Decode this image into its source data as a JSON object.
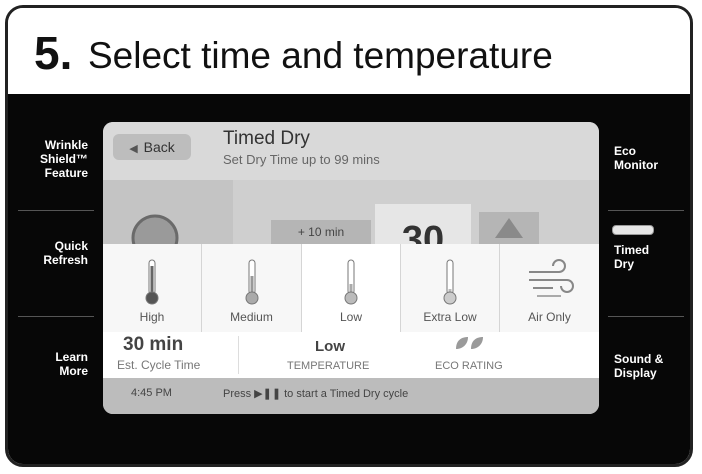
{
  "header": {
    "step_number": "5.",
    "title": "Select time and temperature"
  },
  "left_menu": [
    {
      "id": "wrinkle",
      "lines": [
        "Wrinkle",
        "Shield™",
        "Feature"
      ]
    },
    {
      "id": "quick",
      "lines": [
        "Quick",
        "Refresh"
      ]
    },
    {
      "id": "learn",
      "lines": [
        "Learn",
        "More"
      ]
    }
  ],
  "right_menu": [
    {
      "id": "eco",
      "lines": [
        "Eco",
        "Monitor"
      ]
    },
    {
      "id": "timed",
      "lines": [
        "Timed",
        "Dry"
      ],
      "selected": true
    },
    {
      "id": "sound",
      "lines": [
        "Sound &",
        "Display"
      ]
    }
  ],
  "screen": {
    "back_label": "Back",
    "cycle_title": "Timed Dry",
    "cycle_subtitle": "Set Dry Time up to 99 mins",
    "plus_time": "+ 10 min",
    "time_digits": "30",
    "temperature_options": [
      {
        "label": "High",
        "icon": "thermometer-high-icon"
      },
      {
        "label": "Medium",
        "icon": "thermometer-medium-icon"
      },
      {
        "label": "Low",
        "icon": "thermometer-low-icon",
        "selected": true
      },
      {
        "label": "Extra Low",
        "icon": "thermometer-extra-low-icon"
      },
      {
        "label": "Air Only",
        "icon": "air-wind-icon"
      }
    ],
    "info": {
      "cycle_time_value": "30 min",
      "cycle_time_label": "Est. Cycle Time",
      "temperature_value": "Low",
      "temperature_label": "TEMPERATURE",
      "eco_rating_label": "ECO RATING",
      "eco_rating_icon": "leaf-icon"
    },
    "status": {
      "time": "4:45 PM",
      "hint": "Press ▶❚❚ to start a Timed Dry cycle"
    }
  },
  "colors": {
    "panel": "#070707",
    "screen": "#cfcfcf",
    "text_light": "#ffffff"
  }
}
